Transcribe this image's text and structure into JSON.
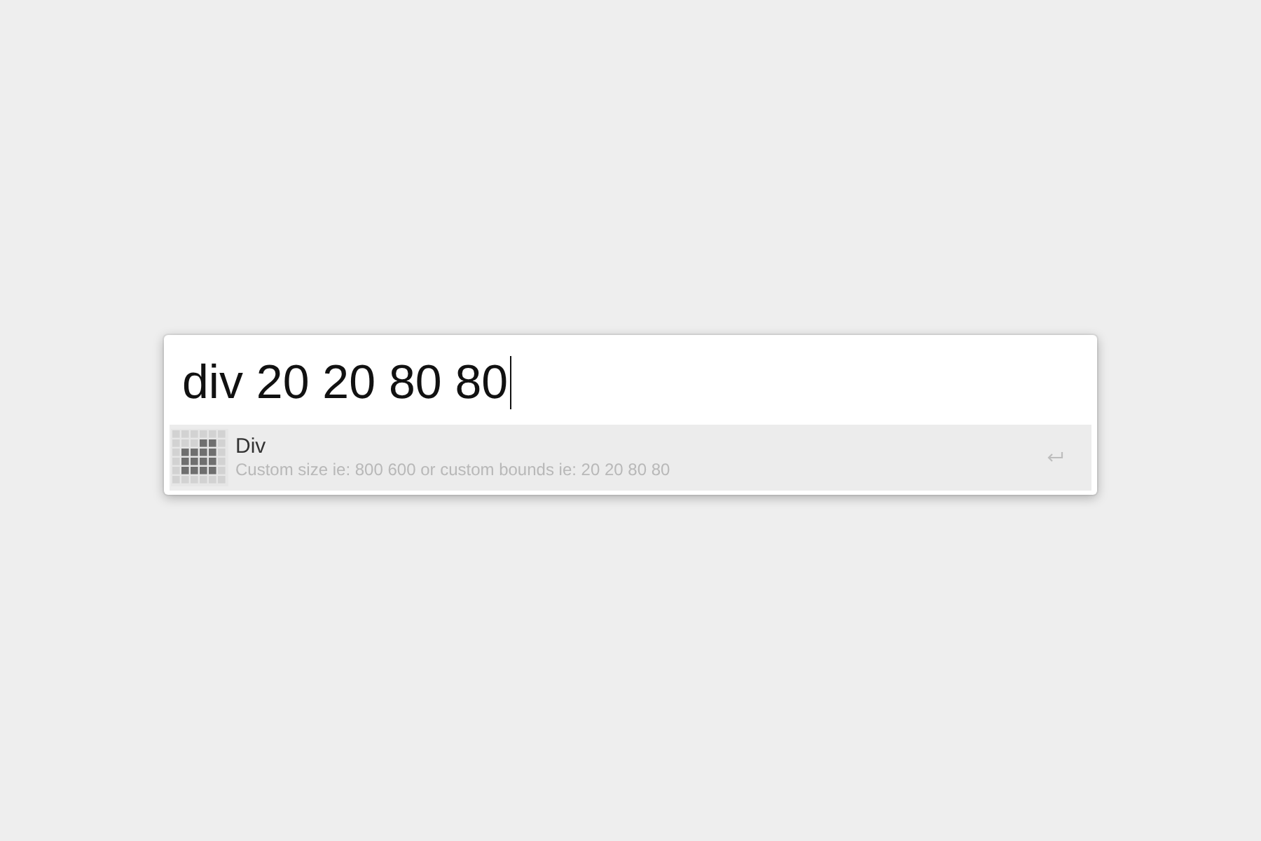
{
  "command_field": {
    "value": "div 20 20 80 80",
    "focused": true
  },
  "results": [
    {
      "title": "Div",
      "subtitle": "Custom size ie: 800 600 or custom bounds ie: 20 20 80 80",
      "selected": true
    }
  ]
}
